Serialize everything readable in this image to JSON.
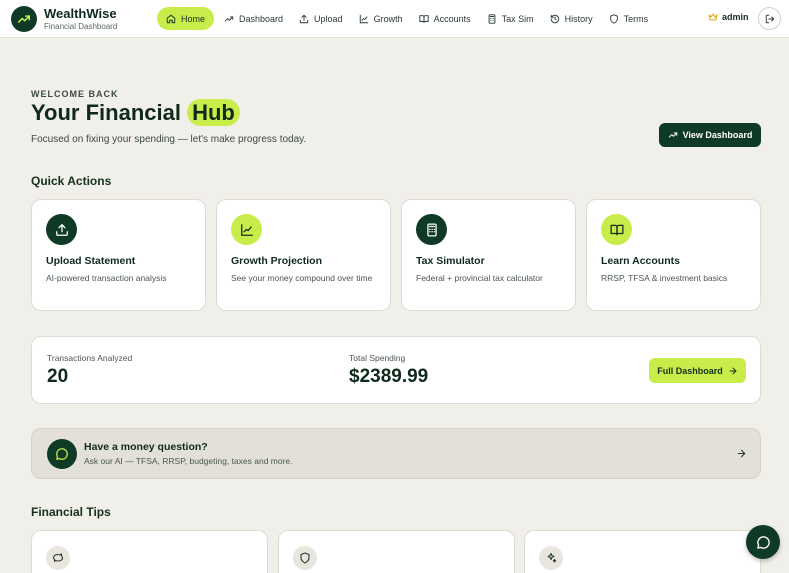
{
  "brand": {
    "name": "WealthWise",
    "subtitle": "Financial Dashboard"
  },
  "nav": {
    "items": [
      {
        "label": "Home",
        "icon": "home-icon",
        "active": true
      },
      {
        "label": "Dashboard",
        "icon": "trend-icon"
      },
      {
        "label": "Upload",
        "icon": "upload-icon"
      },
      {
        "label": "Growth",
        "icon": "chart-icon"
      },
      {
        "label": "Accounts",
        "icon": "book-icon"
      },
      {
        "label": "Tax Sim",
        "icon": "calculator-icon"
      },
      {
        "label": "History",
        "icon": "history-icon"
      },
      {
        "label": "Terms",
        "icon": "shield-icon"
      }
    ],
    "user": "admin"
  },
  "hero": {
    "eyebrow": "WELCOME BACK",
    "title_prefix": "Your Financial",
    "title_highlight": "Hub",
    "subtitle": "Focused on fixing your spending — let's make progress today.",
    "view_dashboard": "View Dashboard"
  },
  "quick_actions": {
    "title": "Quick Actions",
    "cards": [
      {
        "title": "Upload Statement",
        "desc": "AI-powered transaction analysis",
        "icon": "upload-icon"
      },
      {
        "title": "Growth Projection",
        "desc": "See your money compound over time",
        "icon": "chart-icon"
      },
      {
        "title": "Tax Simulator",
        "desc": "Federal + provincial tax calculator",
        "icon": "calculator-icon"
      },
      {
        "title": "Learn Accounts",
        "desc": "RRSP, TFSA & investment basics",
        "icon": "book-icon"
      }
    ]
  },
  "stats": {
    "transactions_label": "Transactions Analyzed",
    "transactions_value": "20",
    "spending_label": "Total Spending",
    "spending_value": "$2389.99",
    "full_dashboard": "Full Dashboard"
  },
  "ai_banner": {
    "title": "Have a money question?",
    "subtitle": "Ask our AI — TFSA, RRSP, budgeting, taxes and more."
  },
  "tips": {
    "title": "Financial Tips"
  },
  "colors": {
    "accent": "#c8ec4a",
    "primary": "#0f3b26",
    "background": "#f1efe9"
  }
}
